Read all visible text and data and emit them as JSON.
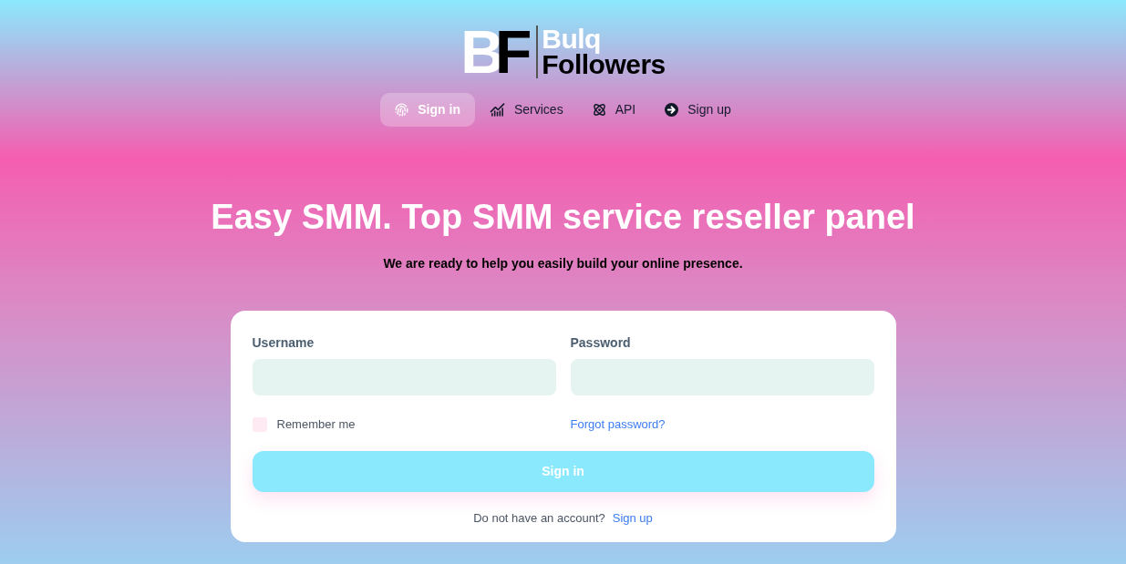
{
  "logo": {
    "mark": [
      "B",
      "F"
    ],
    "name_top": "Bulq",
    "name_bottom": "Followers"
  },
  "nav": [
    {
      "label": "Sign in",
      "kind": "fingerprint",
      "selected": true
    },
    {
      "label": "Services",
      "kind": "chart",
      "selected": false
    },
    {
      "label": "API",
      "kind": "atom",
      "selected": false
    },
    {
      "label": "Sign up",
      "kind": "arrow",
      "selected": false
    }
  ],
  "hero": {
    "title": "Easy SMM. Top SMM service reseller panel",
    "subtitle": "We are ready to help you easily build your online presence."
  },
  "login": {
    "fields": [
      {
        "label": "Username"
      },
      {
        "label": "Password"
      }
    ],
    "remember": {
      "label": "Remember me",
      "checked": false
    },
    "forgot_link": "Forgot password?",
    "submit": "Sign in",
    "signup_prompt": "Do not have an account?",
    "signup_link": "Sign up"
  }
}
